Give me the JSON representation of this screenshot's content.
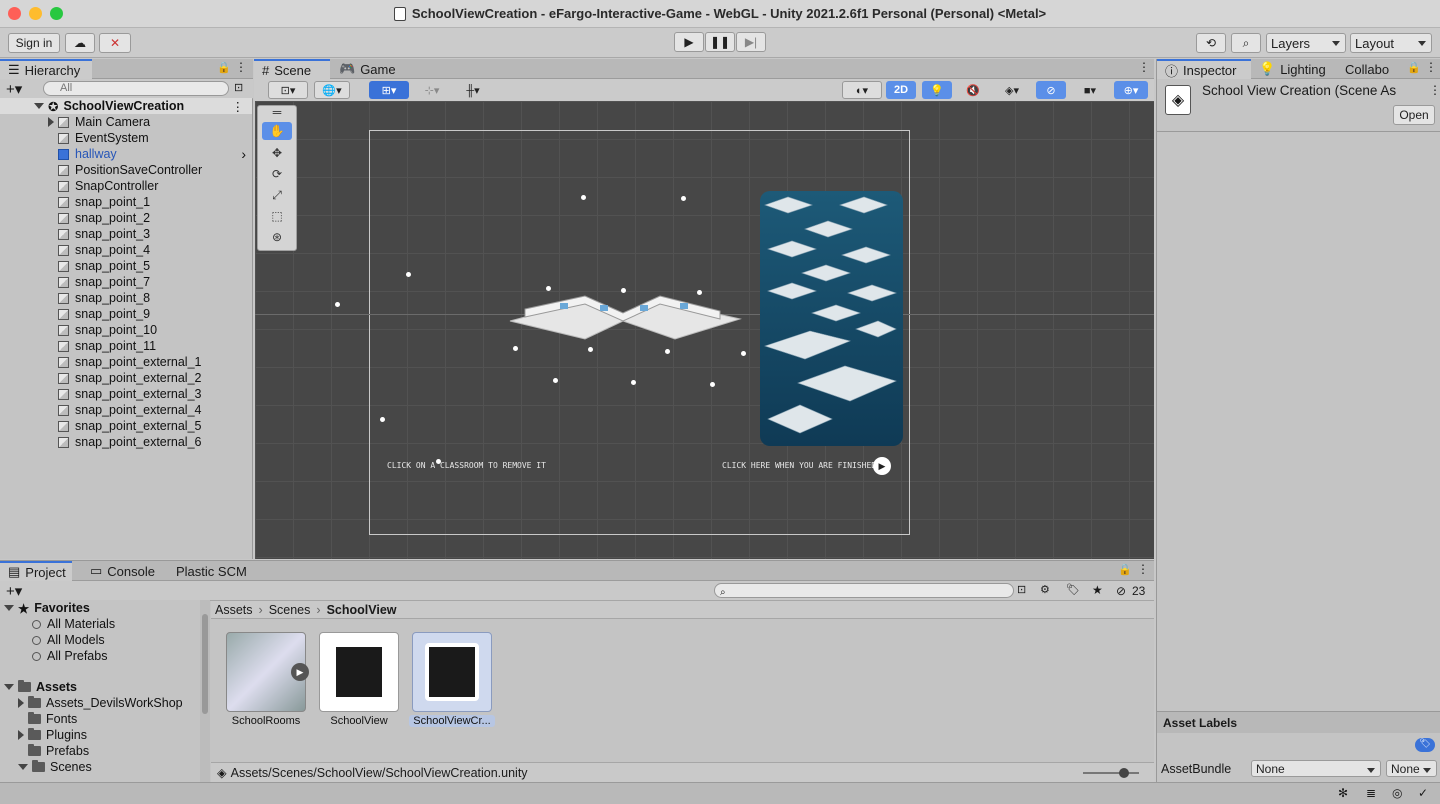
{
  "window": {
    "title": "SchoolViewCreation - eFargo-Interactive-Game - WebGL - Unity 2021.2.6f1 Personal (Personal) <Metal>"
  },
  "toolbar": {
    "sign_in": "Sign in",
    "layers": "Layers",
    "layout": "Layout"
  },
  "hierarchy": {
    "tab": "Hierarchy",
    "search_placeholder": "All",
    "root": "SchoolViewCreation",
    "items": [
      "Main Camera",
      "EventSystem",
      "hallway",
      "PositionSaveController",
      "SnapController",
      "snap_point_1",
      "snap_point_2",
      "snap_point_3",
      "snap_point_4",
      "snap_point_5",
      "snap_point_7",
      "snap_point_8",
      "snap_point_9",
      "snap_point_10",
      "snap_point_11",
      "snap_point_external_1",
      "snap_point_external_2",
      "snap_point_external_3",
      "snap_point_external_4",
      "snap_point_external_5",
      "snap_point_external_6"
    ]
  },
  "scene": {
    "tabs": [
      "Scene",
      "Game"
    ],
    "mode_2d": "2D",
    "hint_left": "CLICK ON A CLASSROOM TO REMOVE IT",
    "hint_right": "CLICK HERE WHEN YOU ARE FINISHED"
  },
  "inspector": {
    "tabs": [
      "Inspector",
      "Lighting",
      "Collabo"
    ],
    "title": "School View Creation (Scene As",
    "open": "Open",
    "asset_labels": "Asset Labels",
    "asset_bundle": "AssetBundle",
    "bundle_none": "None",
    "variant_none": "None"
  },
  "project": {
    "tabs": [
      "Project",
      "Console",
      "Plastic SCM"
    ],
    "hidden_count": "23",
    "favorites": {
      "label": "Favorites",
      "items": [
        "All Materials",
        "All Models",
        "All Prefabs"
      ]
    },
    "assets": {
      "label": "Assets",
      "items": [
        "Assets_DevilsWorkShop",
        "Fonts",
        "Plugins",
        "Prefabs",
        "Scenes"
      ]
    },
    "breadcrumb": [
      "Assets",
      "Scenes",
      "SchoolView"
    ],
    "files": [
      "SchoolRooms",
      "SchoolView",
      "SchoolViewCr..."
    ],
    "path": "Assets/Scenes/SchoolView/SchoolViewCreation.unity"
  },
  "colors": {
    "accent": "#3a72d8",
    "scene_bg": "#474747"
  }
}
